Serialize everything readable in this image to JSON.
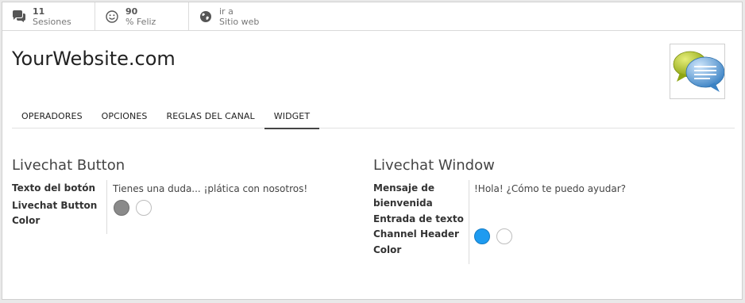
{
  "stats": [
    {
      "value": "11",
      "label": "Sesiones",
      "icon": "chat-icon"
    },
    {
      "value": "90",
      "label": "% Feliz",
      "icon": "smiley-icon"
    },
    {
      "value": "ir a",
      "label": "Sitio web",
      "icon": "globe-icon"
    }
  ],
  "page": {
    "title": "YourWebsite.com"
  },
  "tabs": [
    {
      "label": "OPERADORES"
    },
    {
      "label": "OPCIONES"
    },
    {
      "label": "REGLAS DEL CANAL"
    },
    {
      "label": "WIDGET",
      "active": true
    }
  ],
  "button_section": {
    "title": "Livechat Button",
    "text_label": "Texto del botón",
    "text_value": "Tienes una duda... ¡plática con nosotros!",
    "color_label_1": "Livechat Button",
    "color_label_2": "Color",
    "colors": [
      "#8a8a8a",
      "#ffffff"
    ]
  },
  "window_section": {
    "title": "Livechat Window",
    "welcome_label_1": "Mensaje de",
    "welcome_label_2": "bienvenida",
    "welcome_value": "!Hola! ¿Cómo te puedo ayudar?",
    "input_label": "Entrada de texto",
    "header_label_1": "Channel Header",
    "header_label_2": "Color",
    "colors": [
      "#1e9bf0",
      "#ffffff"
    ]
  }
}
